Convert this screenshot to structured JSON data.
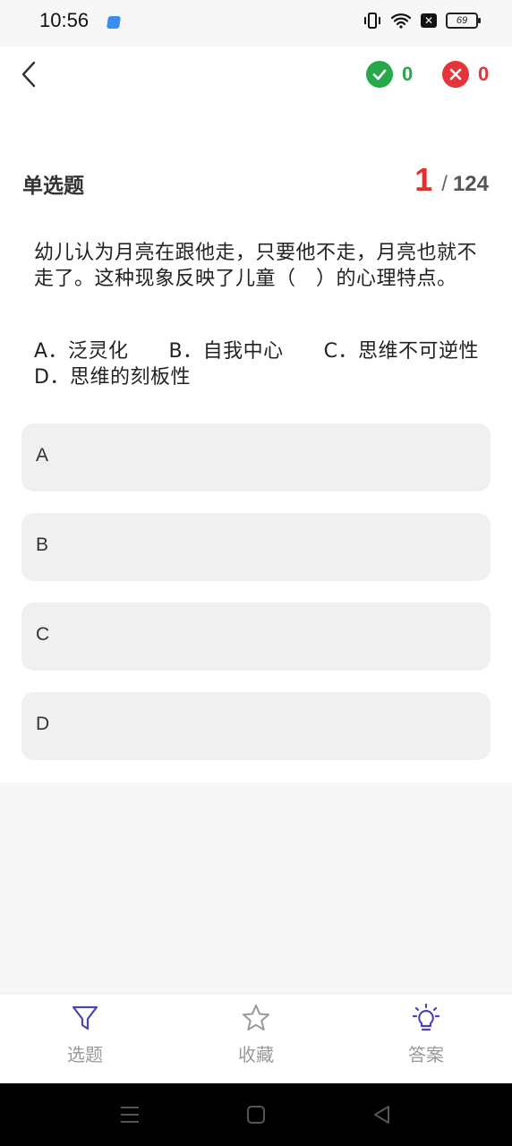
{
  "status_bar": {
    "time": "10:56",
    "battery": "69",
    "notification_icon": "x-box-icon"
  },
  "header": {
    "back_icon": "chevron-left-icon",
    "correct_count": "0",
    "wrong_count": "0",
    "colors": {
      "correct": "#27a84a",
      "wrong": "#e6343a"
    }
  },
  "question": {
    "type_label": "单选题",
    "current": "1",
    "separator": "/",
    "total": "124",
    "text": "幼儿认为月亮在跟他走，只要他不走，月亮也就不走了。这种现象反映了儿童（　）的心理特点。",
    "options_text": "A．泛灵化　　B．自我中心　　C．思维不可逆性　　D．思维的刻板性"
  },
  "answers": [
    {
      "label": "A"
    },
    {
      "label": "B"
    },
    {
      "label": "C"
    },
    {
      "label": "D"
    }
  ],
  "bottom_nav": {
    "items": [
      {
        "label": "选题",
        "icon": "filter-icon"
      },
      {
        "label": "收藏",
        "icon": "star-icon"
      },
      {
        "label": "答案",
        "icon": "lightbulb-icon"
      }
    ],
    "accent": "#4a44b8"
  }
}
